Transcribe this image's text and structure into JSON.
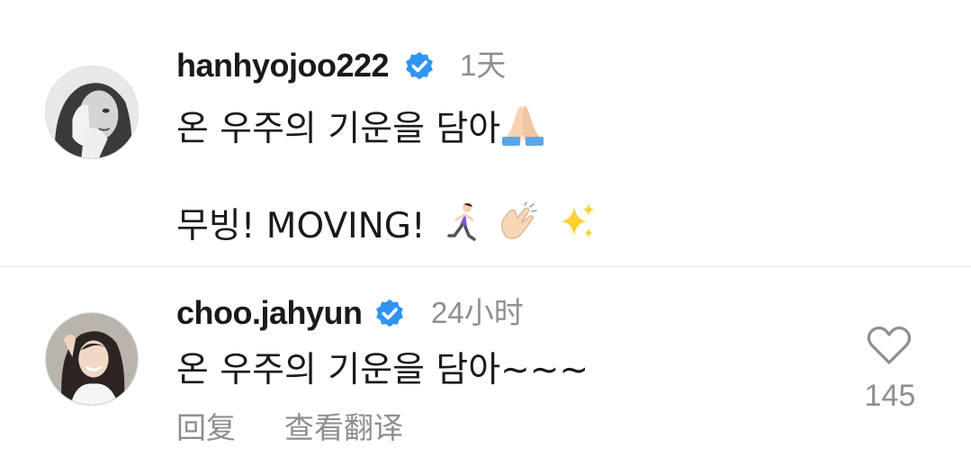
{
  "comments": [
    {
      "username": "hanhyojoo222",
      "time": "1天",
      "line1": "온 우주의 기운을 담아",
      "line1_emoji": "folded-hands",
      "line2": "무빙! MOVING!",
      "line2_emojis": [
        "woman-running",
        "clapping-hands",
        "sparkles"
      ]
    },
    {
      "username": "choo.jahyun",
      "time": "24小时",
      "text": "온 우주의 기운을 담아~~~",
      "reply_label": "回复",
      "translate_label": "查看翻译",
      "like_count": "145"
    }
  ],
  "colors": {
    "verified": "#2f95f3",
    "secondary_text": "#8e8e8e",
    "primary_text": "#1a1a1a"
  }
}
